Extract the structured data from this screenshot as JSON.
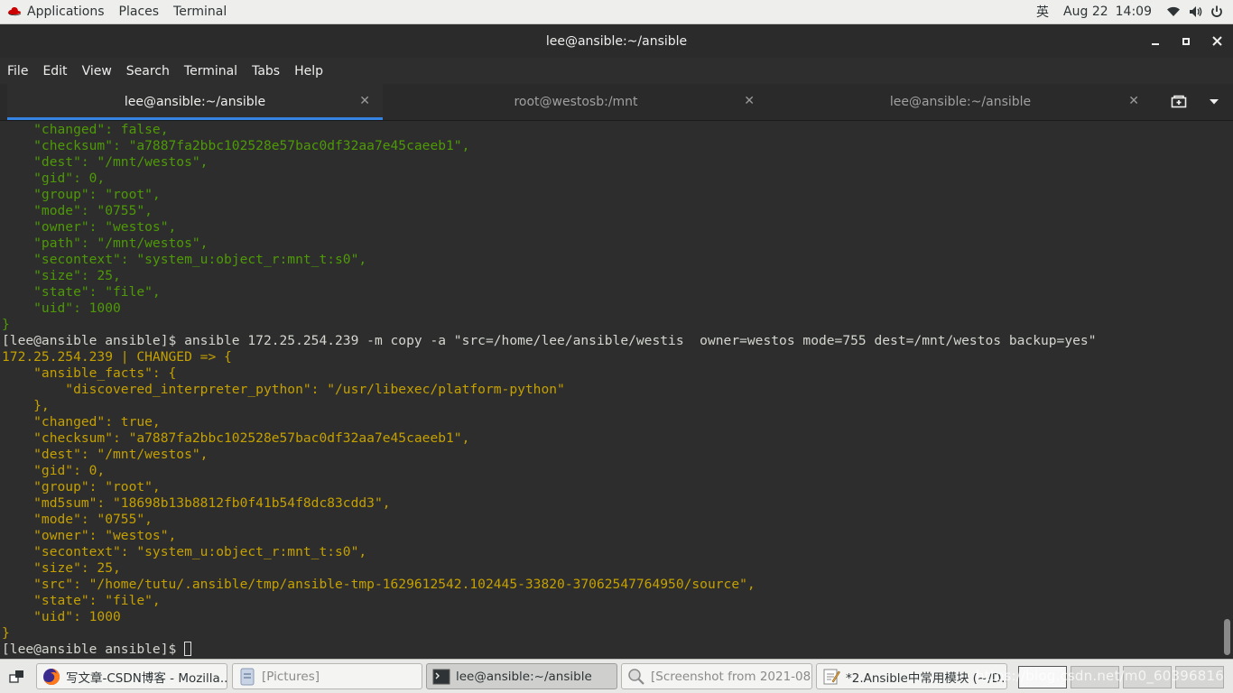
{
  "topbar": {
    "applications": "Applications",
    "places": "Places",
    "terminal": "Terminal",
    "input_method": "英",
    "date": "Aug 22",
    "time": "14:09"
  },
  "window": {
    "title": "lee@ansible:~/ansible"
  },
  "menubar": {
    "items": [
      "File",
      "Edit",
      "View",
      "Search",
      "Terminal",
      "Tabs",
      "Help"
    ]
  },
  "tabs": [
    {
      "label": "lee@ansible:~/ansible",
      "active": true
    },
    {
      "label": "root@westosb:/mnt",
      "active": false
    },
    {
      "label": "lee@ansible:~/ansible",
      "active": false
    }
  ],
  "terminal": {
    "lines": [
      {
        "text": "    \"changed\": false,",
        "color": "green"
      },
      {
        "text": "    \"checksum\": \"a7887fa2bbc102528e57bac0df32aa7e45caeeb1\",",
        "color": "green"
      },
      {
        "text": "    \"dest\": \"/mnt/westos\",",
        "color": "green"
      },
      {
        "text": "    \"gid\": 0,",
        "color": "green"
      },
      {
        "text": "    \"group\": \"root\",",
        "color": "green"
      },
      {
        "text": "    \"mode\": \"0755\",",
        "color": "green"
      },
      {
        "text": "    \"owner\": \"westos\",",
        "color": "green"
      },
      {
        "text": "    \"path\": \"/mnt/westos\",",
        "color": "green"
      },
      {
        "text": "    \"secontext\": \"system_u:object_r:mnt_t:s0\",",
        "color": "green"
      },
      {
        "text": "    \"size\": 25,",
        "color": "green"
      },
      {
        "text": "    \"state\": \"file\",",
        "color": "green"
      },
      {
        "text": "    \"uid\": 1000",
        "color": "green"
      },
      {
        "text": "}",
        "color": "green"
      },
      {
        "text": "[lee@ansible ansible]$ ansible 172.25.254.239 -m copy -a \"src=/home/lee/ansible/westis  owner=westos mode=755 dest=/mnt/westos backup=yes\"",
        "color": "white"
      },
      {
        "text": "172.25.254.239 | CHANGED => {",
        "color": "yellow"
      },
      {
        "text": "    \"ansible_facts\": {",
        "color": "yellow"
      },
      {
        "text": "        \"discovered_interpreter_python\": \"/usr/libexec/platform-python\"",
        "color": "yellow"
      },
      {
        "text": "    },",
        "color": "yellow"
      },
      {
        "text": "    \"changed\": true,",
        "color": "yellow"
      },
      {
        "text": "    \"checksum\": \"a7887fa2bbc102528e57bac0df32aa7e45caeeb1\",",
        "color": "yellow"
      },
      {
        "text": "    \"dest\": \"/mnt/westos\",",
        "color": "yellow"
      },
      {
        "text": "    \"gid\": 0,",
        "color": "yellow"
      },
      {
        "text": "    \"group\": \"root\",",
        "color": "yellow"
      },
      {
        "text": "    \"md5sum\": \"18698b13b8812fb0f41b54f8dc83cdd3\",",
        "color": "yellow"
      },
      {
        "text": "    \"mode\": \"0755\",",
        "color": "yellow"
      },
      {
        "text": "    \"owner\": \"westos\",",
        "color": "yellow"
      },
      {
        "text": "    \"secontext\": \"system_u:object_r:mnt_t:s0\",",
        "color": "yellow"
      },
      {
        "text": "    \"size\": 25,",
        "color": "yellow"
      },
      {
        "text": "    \"src\": \"/home/tutu/.ansible/tmp/ansible-tmp-1629612542.102445-33820-37062547764950/source\",",
        "color": "yellow"
      },
      {
        "text": "    \"state\": \"file\",",
        "color": "yellow"
      },
      {
        "text": "    \"uid\": 1000",
        "color": "yellow"
      },
      {
        "text": "}",
        "color": "yellow"
      }
    ],
    "prompt": "[lee@ansible ansible]$ ",
    "colors": {
      "green": "#4e9a06",
      "yellow": "#c4a000",
      "white": "#d3d7cf"
    }
  },
  "taskbar": {
    "tasks": [
      {
        "label": "写文章-CSDN博客 - Mozilla...",
        "icon": "firefox-icon",
        "state": "normal"
      },
      {
        "label": "[Pictures]",
        "icon": "folder-icon",
        "state": "minimized"
      },
      {
        "label": "lee@ansible:~/ansible",
        "icon": "terminal-icon",
        "state": "active"
      },
      {
        "label": "[Screenshot from 2021-08...",
        "icon": "image-viewer-icon",
        "state": "minimized"
      },
      {
        "label": "*2.Ansible中常用模块 (~/D...",
        "icon": "text-editor-icon",
        "state": "normal"
      }
    ],
    "watermark": "https://blog.csdn.net/m0_60396816"
  }
}
